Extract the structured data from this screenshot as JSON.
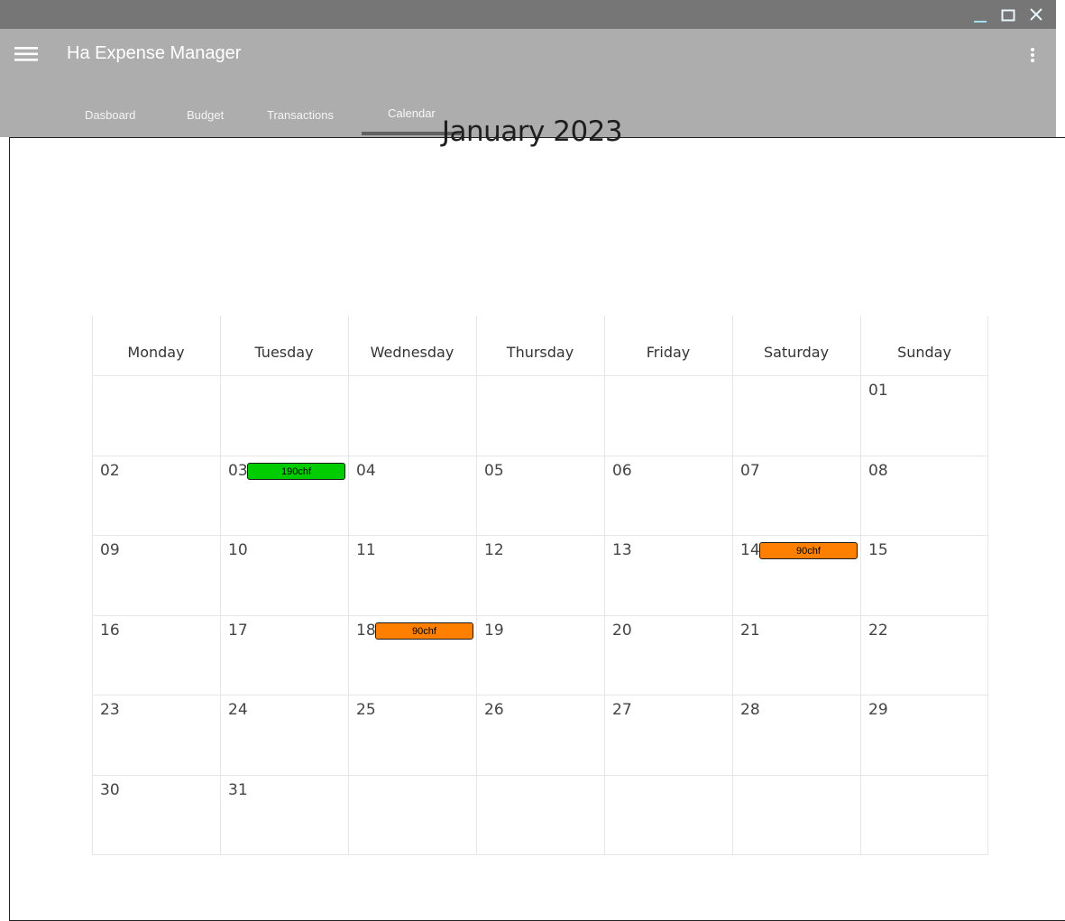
{
  "app": {
    "title": "Ha Expense Manager"
  },
  "tabs": [
    {
      "label": "Dasboard"
    },
    {
      "label": "Budget"
    },
    {
      "label": "Transactions"
    },
    {
      "label": "Calendar"
    }
  ],
  "active_tab": "Calendar",
  "calendar": {
    "title": "January 2023",
    "weekdays": [
      "Monday",
      "Tuesday",
      "Wednesday",
      "Thursday",
      "Friday",
      "Saturday",
      "Sunday"
    ],
    "weeks": [
      [
        "",
        "",
        "",
        "",
        "",
        "",
        "01"
      ],
      [
        "02",
        "03",
        "04",
        "05",
        "06",
        "07",
        "08"
      ],
      [
        "09",
        "10",
        "11",
        "12",
        "13",
        "14",
        "15"
      ],
      [
        "16",
        "17",
        "18",
        "19",
        "20",
        "21",
        "22"
      ],
      [
        "23",
        "24",
        "25",
        "26",
        "27",
        "28",
        "29"
      ],
      [
        "30",
        "31",
        "",
        "",
        "",
        "",
        ""
      ]
    ],
    "events": [
      {
        "day": "03",
        "label": "190chf",
        "color": "#00cc00"
      },
      {
        "day": "14",
        "label": "90chf",
        "color": "#ff8000"
      },
      {
        "day": "18",
        "label": "90chf",
        "color": "#ff8000"
      }
    ]
  },
  "colors": {
    "titlebar": "#767676",
    "appbar": "#adadad",
    "tab_indicator": "#606060"
  }
}
